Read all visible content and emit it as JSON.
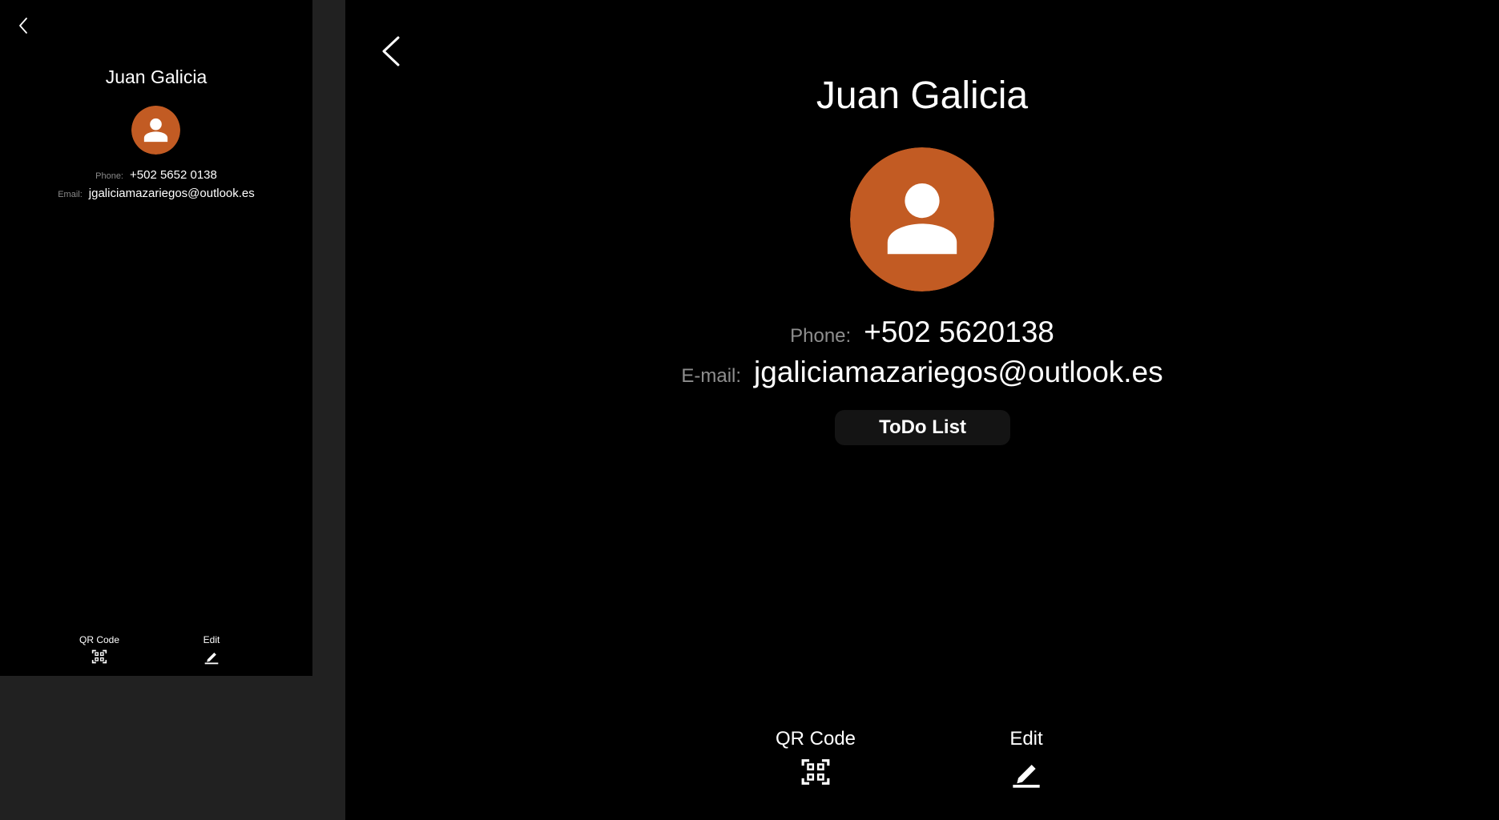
{
  "colors": {
    "accent": "#c25b23",
    "background": "#000000",
    "side_panel": "#212121",
    "label": "#8a8a8a",
    "button_bg": "#141414"
  },
  "preview": {
    "back_icon": "chevron-left-icon",
    "contact_name": "Juan Galicia",
    "avatar_icon": "person-icon",
    "phone_label": "Phone:",
    "phone_value": "+502 5652 0138",
    "email_label": "Email:",
    "email_value": "jgaliciamazariegos@outlook.es",
    "qr_label": "QR Code",
    "qr_icon": "qr-scan-icon",
    "edit_label": "Edit",
    "edit_icon": "pencil-icon"
  },
  "detail": {
    "back_icon": "chevron-left-icon",
    "contact_name": "Juan Galicia",
    "avatar_icon": "person-icon",
    "phone_label": "Phone:",
    "phone_value": "+502 5620138",
    "email_label": "E-mail:",
    "email_value": "jgaliciamazariegos@outlook.es",
    "todo_button": "ToDo List",
    "qr_label": "QR Code",
    "qr_icon": "qr-scan-icon",
    "edit_label": "Edit",
    "edit_icon": "pencil-icon"
  }
}
